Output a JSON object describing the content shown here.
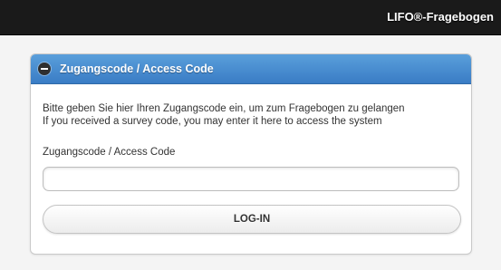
{
  "topbar": {
    "title": "LIFO®-Fragebogen"
  },
  "panel": {
    "icon": "minus-circle-icon",
    "title": "Zugangscode / Access Code",
    "instructions": [
      "Bitte geben Sie hier Ihren Zugangscode ein, um zum Fragebogen zu gelangen",
      "If you received a survey code, you may enter it here to access the system"
    ],
    "field_label": "Zugangscode / Access Code",
    "input": {
      "value": "",
      "placeholder": ""
    },
    "login_label": "LOG-IN"
  },
  "colors": {
    "topbar": "#1a1a1a",
    "header_accent": "#4a8fd3",
    "background": "#f4f4f4"
  }
}
